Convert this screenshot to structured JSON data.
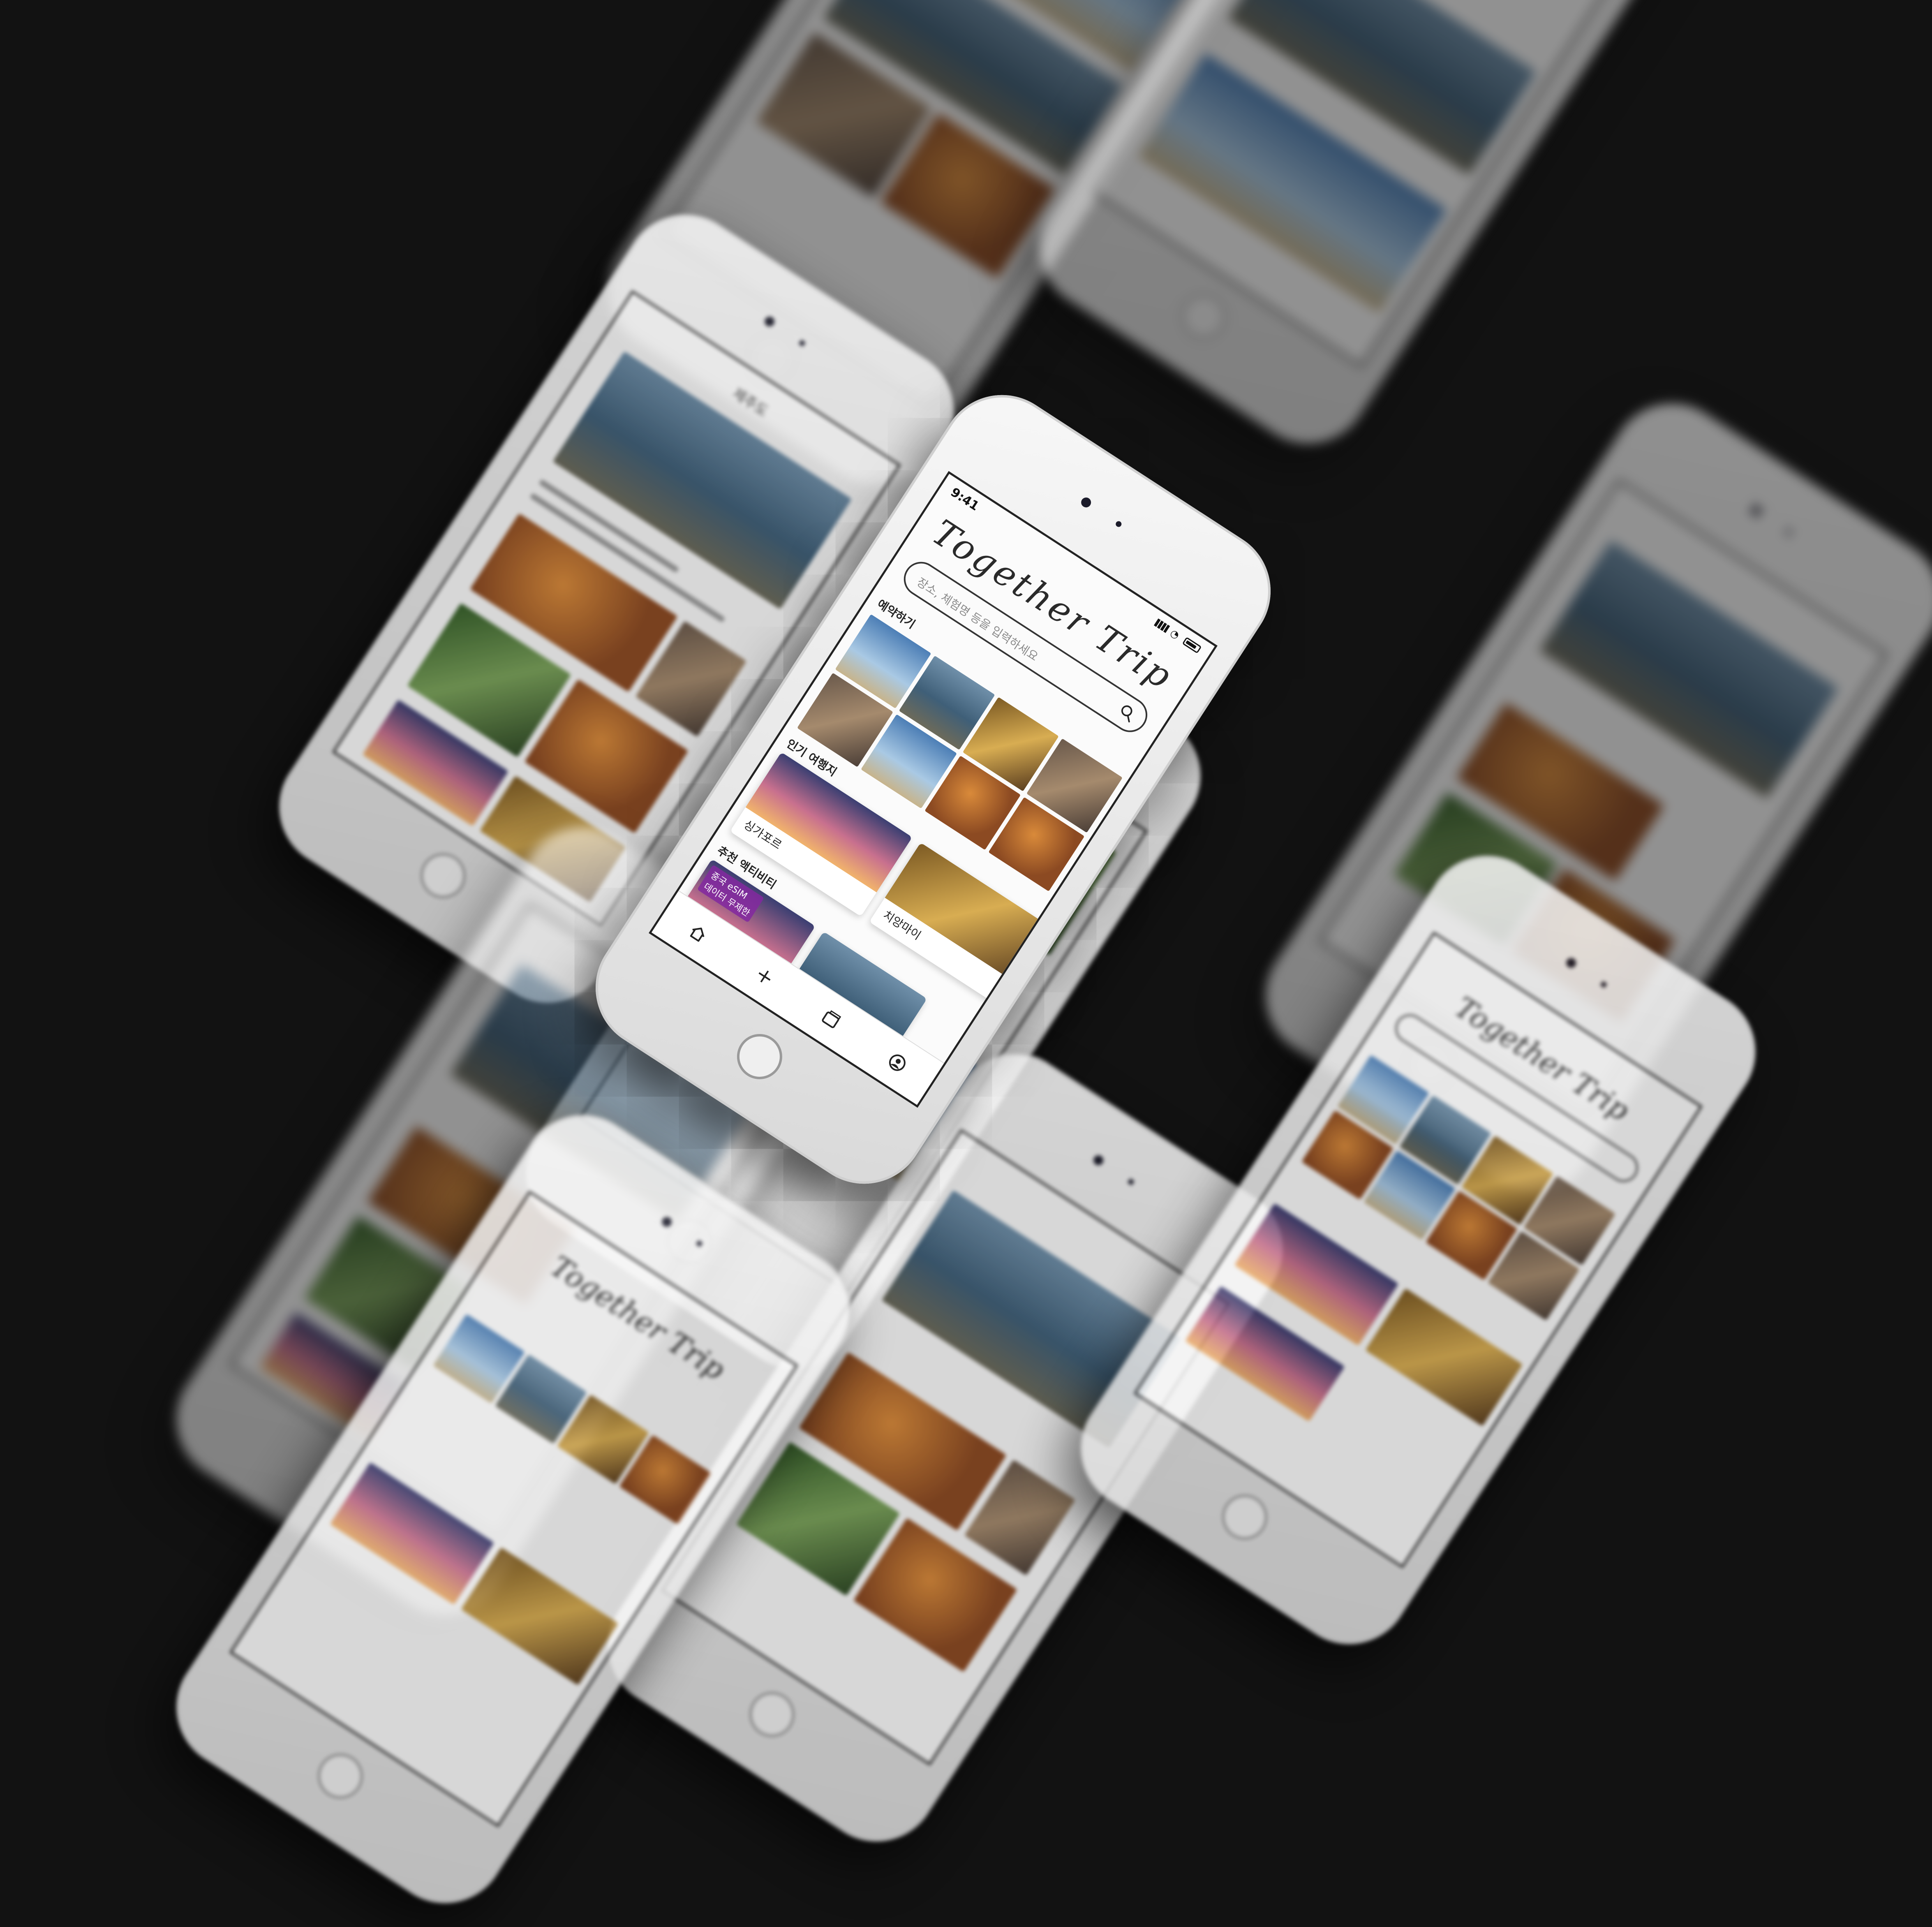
{
  "app": {
    "title": "Together Trip",
    "status_time": "9:41"
  },
  "search": {
    "placeholder": "장소, 체험명 등을 입력하세요"
  },
  "sections": {
    "booking": "예약하기",
    "popular": "인기 여행지",
    "activities": "추천 액티비티"
  },
  "destinations": [
    "싱가포르",
    "치앙마이"
  ],
  "activity_badges": [
    "중국 eSIM",
    "데이터 무제한"
  ],
  "tabbar": {
    "items": [
      "home-icon",
      "plus-icon",
      "gallery-icon",
      "profile-icon"
    ]
  },
  "secondary_screen": {
    "title": "제주도"
  }
}
